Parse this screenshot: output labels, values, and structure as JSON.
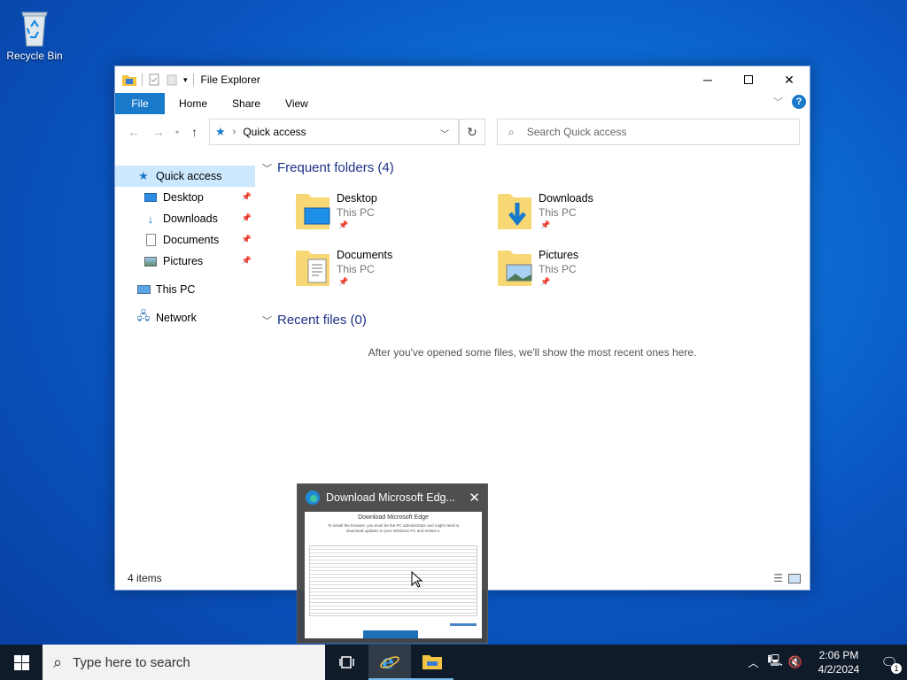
{
  "desktop": {
    "recycle_bin": "Recycle Bin"
  },
  "window": {
    "title": "File Explorer",
    "tabs": [
      "File",
      "Home",
      "Share",
      "View"
    ],
    "address": "Quick access",
    "search_placeholder": "Search Quick access",
    "sidebar": [
      {
        "label": "Quick access",
        "pinned": false
      },
      {
        "label": "Desktop",
        "pinned": true
      },
      {
        "label": "Downloads",
        "pinned": true
      },
      {
        "label": "Documents",
        "pinned": true
      },
      {
        "label": "Pictures",
        "pinned": true
      },
      {
        "label": "This PC",
        "pinned": false
      },
      {
        "label": "Network",
        "pinned": false
      }
    ],
    "frequent_header": "Frequent folders (4)",
    "folders": [
      {
        "name": "Desktop",
        "location": "This PC"
      },
      {
        "name": "Downloads",
        "location": "This PC"
      },
      {
        "name": "Documents",
        "location": "This PC"
      },
      {
        "name": "Pictures",
        "location": "This PC"
      }
    ],
    "recent_header": "Recent files (0)",
    "recent_empty": "After you've opened some files, we'll show the most recent ones here.",
    "status": "4 items"
  },
  "preview": {
    "title": "Download Microsoft Edg...",
    "page_heading": "Download Microsoft Edge",
    "page_text": "To install the browser, you must be the PC administrator and might need to download updates to your Windows PC and restart it."
  },
  "taskbar": {
    "search_placeholder": "Type here to search",
    "time": "2:06 PM",
    "date": "4/2/2024",
    "notification_count": "1"
  }
}
